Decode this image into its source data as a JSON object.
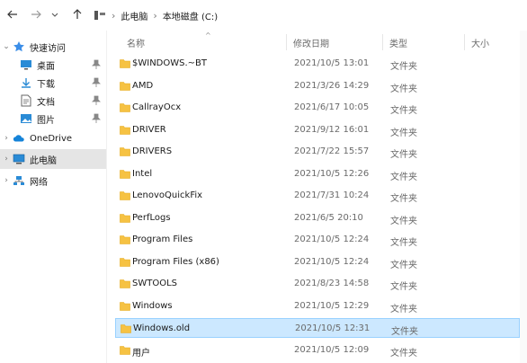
{
  "nav": {
    "back_icon": "arrow-left-icon",
    "forward_icon": "arrow-right-icon",
    "recent_icon": "chevron-down-icon",
    "up_icon": "arrow-up-icon"
  },
  "breadcrumb": {
    "items": [
      "此电脑",
      "本地磁盘 (C:)"
    ],
    "separator": "›"
  },
  "sidebar": {
    "items": [
      {
        "label": "快速访问",
        "icon": "star-icon"
      },
      {
        "label": "桌面",
        "icon": "desktop-icon",
        "pinned": true
      },
      {
        "label": "下载",
        "icon": "download-icon",
        "pinned": true
      },
      {
        "label": "文档",
        "icon": "document-icon",
        "pinned": true
      },
      {
        "label": "图片",
        "icon": "picture-icon",
        "pinned": true
      },
      {
        "label": "OneDrive",
        "icon": "cloud-icon"
      },
      {
        "label": "此电脑",
        "icon": "computer-icon",
        "selected": true
      },
      {
        "label": "网络",
        "icon": "network-icon"
      }
    ]
  },
  "columns": {
    "name": "名称",
    "modified": "修改日期",
    "type": "类型",
    "size": "大小"
  },
  "files": [
    {
      "name": "$WINDOWS.~BT",
      "modified": "2021/10/5 13:01",
      "type": "文件夹"
    },
    {
      "name": "AMD",
      "modified": "2021/3/26 14:29",
      "type": "文件夹"
    },
    {
      "name": "CallrayOcx",
      "modified": "2021/6/17 10:05",
      "type": "文件夹"
    },
    {
      "name": "DRIVER",
      "modified": "2021/9/12 16:01",
      "type": "文件夹"
    },
    {
      "name": "DRIVERS",
      "modified": "2021/7/22 15:57",
      "type": "文件夹"
    },
    {
      "name": "Intel",
      "modified": "2021/10/5 12:26",
      "type": "文件夹"
    },
    {
      "name": "LenovoQuickFix",
      "modified": "2021/7/31 10:24",
      "type": "文件夹"
    },
    {
      "name": "PerfLogs",
      "modified": "2021/6/5 20:10",
      "type": "文件夹"
    },
    {
      "name": "Program Files",
      "modified": "2021/10/5 12:24",
      "type": "文件夹"
    },
    {
      "name": "Program Files (x86)",
      "modified": "2021/10/5 12:24",
      "type": "文件夹"
    },
    {
      "name": "SWTOOLS",
      "modified": "2021/8/23 14:58",
      "type": "文件夹"
    },
    {
      "name": "Windows",
      "modified": "2021/10/5 12:29",
      "type": "文件夹"
    },
    {
      "name": "Windows.old",
      "modified": "2021/10/5 12:31",
      "type": "文件夹",
      "selected": true
    },
    {
      "name": "用户",
      "modified": "2021/10/5 12:09",
      "type": "文件夹"
    }
  ],
  "colors": {
    "folder": "#f6c243",
    "folder_dark": "#e6a817",
    "selection_bg": "#cce8ff",
    "selection_border": "#99d1ff",
    "sidebar_selected": "#e5e5e5",
    "accent": "#0078d4"
  }
}
